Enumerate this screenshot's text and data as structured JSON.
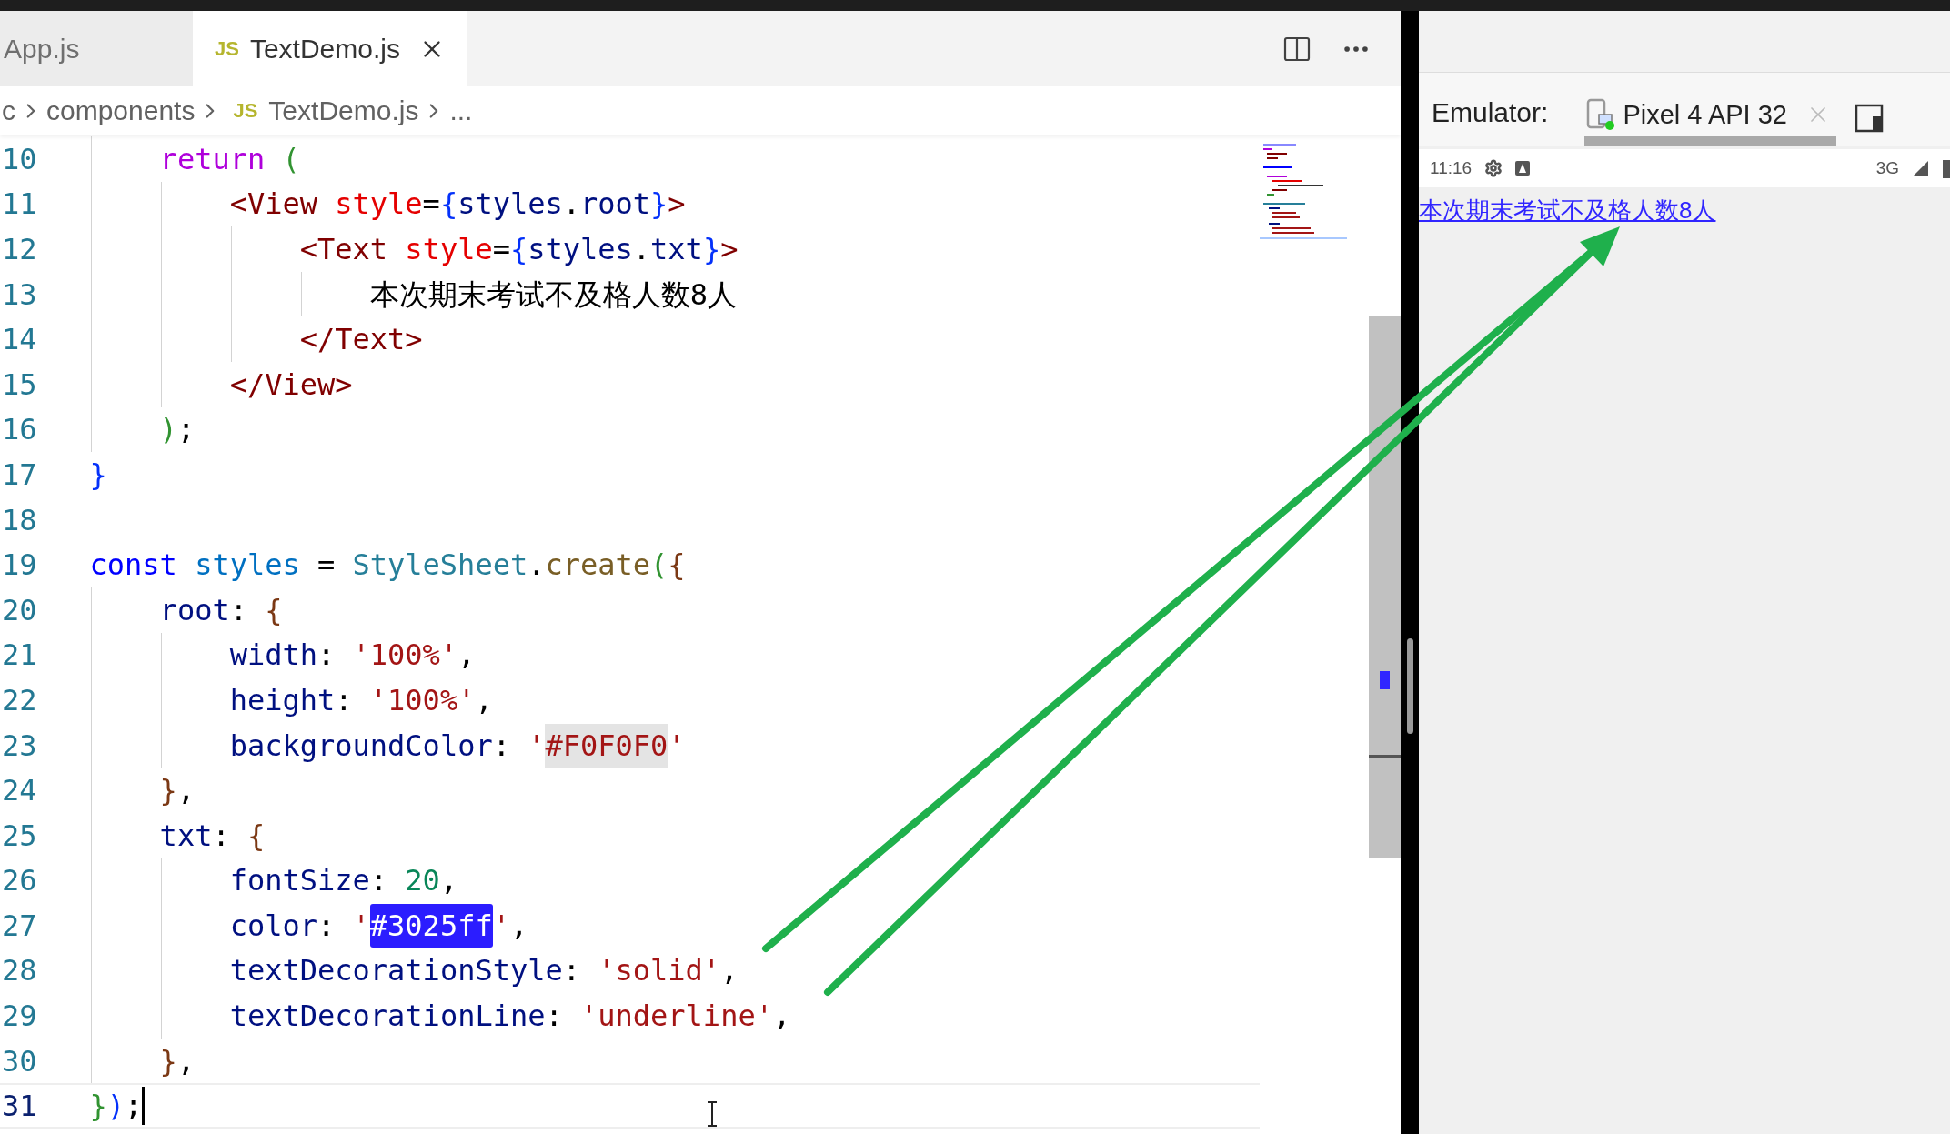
{
  "editor": {
    "tabs": [
      {
        "label": "App.js",
        "selected": false
      },
      {
        "label": "TextDemo.js",
        "badge": "JS",
        "selected": true
      }
    ],
    "breadcrumb": [
      {
        "text": "c"
      },
      {
        "text": "components"
      },
      {
        "text": "TextDemo.js",
        "badge": "JS"
      },
      {
        "text": "..."
      }
    ],
    "lines": [
      {
        "number": "10",
        "current": false,
        "tokens": [
          {
            "kind": "control",
            "text": "    return"
          },
          {
            "kind": "bracket2",
            "text": " ("
          }
        ]
      },
      {
        "number": "11",
        "current": false,
        "tokens": [
          {
            "kind": "tag",
            "text": "        <View"
          },
          {
            "kind": "attr",
            "text": " style"
          },
          {
            "kind": "plain",
            "text": "="
          },
          {
            "kind": "bracket1",
            "text": "{"
          },
          {
            "kind": "var",
            "text": "styles"
          },
          {
            "kind": "plain",
            "text": "."
          },
          {
            "kind": "var",
            "text": "root"
          },
          {
            "kind": "bracket1",
            "text": "}"
          },
          {
            "kind": "tag",
            "text": ">"
          }
        ]
      },
      {
        "number": "12",
        "current": false,
        "tokens": [
          {
            "kind": "tag",
            "text": "            <Text"
          },
          {
            "kind": "attr",
            "text": " style"
          },
          {
            "kind": "plain",
            "text": "="
          },
          {
            "kind": "bracket1",
            "text": "{"
          },
          {
            "kind": "var",
            "text": "styles"
          },
          {
            "kind": "plain",
            "text": "."
          },
          {
            "kind": "var",
            "text": "txt"
          },
          {
            "kind": "bracket1",
            "text": "}"
          },
          {
            "kind": "tag",
            "text": ">"
          }
        ]
      },
      {
        "number": "13",
        "current": false,
        "tokens": [
          {
            "kind": "plain",
            "text": "                本次期末考试不及格人数8人"
          }
        ]
      },
      {
        "number": "14",
        "current": false,
        "tokens": [
          {
            "kind": "tag",
            "text": "            </Text>"
          }
        ]
      },
      {
        "number": "15",
        "current": false,
        "tokens": [
          {
            "kind": "tag",
            "text": "        </View>"
          }
        ]
      },
      {
        "number": "16",
        "current": false,
        "tokens": [
          {
            "kind": "bracket2",
            "text": "    )"
          },
          {
            "kind": "plain",
            "text": ";"
          }
        ]
      },
      {
        "number": "17",
        "current": false,
        "tokens": [
          {
            "kind": "bracket1",
            "text": "}"
          }
        ]
      },
      {
        "number": "18",
        "current": false
      },
      {
        "number": "19",
        "current": false,
        "tokens": [
          {
            "kind": "keyword",
            "text": "const"
          },
          {
            "kind": "const",
            "text": " styles"
          },
          {
            "kind": "plain",
            "text": " = "
          },
          {
            "kind": "type",
            "text": "StyleSheet"
          },
          {
            "kind": "plain",
            "text": "."
          },
          {
            "kind": "func",
            "text": "create"
          },
          {
            "kind": "bracket2",
            "text": "("
          },
          {
            "kind": "bracket3",
            "text": "{"
          }
        ]
      },
      {
        "number": "20",
        "current": false,
        "tokens": [
          {
            "kind": "var",
            "text": "    root"
          },
          {
            "kind": "plain",
            "text": ": "
          },
          {
            "kind": "bracket3",
            "text": "{"
          }
        ]
      },
      {
        "number": "21",
        "current": false,
        "tokens": [
          {
            "kind": "var",
            "text": "        width"
          },
          {
            "kind": "plain",
            "text": ": "
          },
          {
            "kind": "string",
            "text": "'100%'"
          },
          {
            "kind": "plain",
            "text": ","
          }
        ]
      },
      {
        "number": "22",
        "current": false,
        "tokens": [
          {
            "kind": "var",
            "text": "        height"
          },
          {
            "kind": "plain",
            "text": ": "
          },
          {
            "kind": "string",
            "text": "'100%'"
          },
          {
            "kind": "plain",
            "text": ","
          }
        ]
      },
      {
        "number": "23",
        "current": false,
        "tokens": [
          {
            "kind": "var",
            "text": "        backgroundColor"
          },
          {
            "kind": "plain",
            "text": ": "
          },
          {
            "kind": "string",
            "text": "'"
          },
          {
            "kind": "match",
            "text": "#F0F0F0"
          },
          {
            "kind": "string",
            "text": "'"
          }
        ]
      },
      {
        "number": "24",
        "current": false,
        "tokens": [
          {
            "kind": "bracket3",
            "text": "    }"
          },
          {
            "kind": "plain",
            "text": ","
          }
        ]
      },
      {
        "number": "25",
        "current": false,
        "tokens": [
          {
            "kind": "var",
            "text": "    txt"
          },
          {
            "kind": "plain",
            "text": ": "
          },
          {
            "kind": "bracket3",
            "text": "{"
          }
        ]
      },
      {
        "number": "26",
        "current": false,
        "tokens": [
          {
            "kind": "var",
            "text": "        fontSize"
          },
          {
            "kind": "plain",
            "text": ": "
          },
          {
            "kind": "number",
            "text": "20"
          },
          {
            "kind": "plain",
            "text": ","
          }
        ]
      },
      {
        "number": "27",
        "current": false,
        "tokens": [
          {
            "kind": "var",
            "text": "        color"
          },
          {
            "kind": "plain",
            "text": ": "
          },
          {
            "kind": "string",
            "text": "'"
          },
          {
            "kind": "selection",
            "text": "#3025ff"
          },
          {
            "kind": "string",
            "text": "'"
          },
          {
            "kind": "plain",
            "text": ","
          }
        ]
      },
      {
        "number": "28",
        "current": false,
        "tokens": [
          {
            "kind": "var",
            "text": "        textDecorationStyle"
          },
          {
            "kind": "plain",
            "text": ": "
          },
          {
            "kind": "string",
            "text": "'solid'"
          },
          {
            "kind": "plain",
            "text": ","
          }
        ]
      },
      {
        "number": "29",
        "current": false,
        "tokens": [
          {
            "kind": "var",
            "text": "        textDecorationLine"
          },
          {
            "kind": "plain",
            "text": ": "
          },
          {
            "kind": "string",
            "text": "'underline'"
          },
          {
            "kind": "plain",
            "text": ","
          }
        ]
      },
      {
        "number": "30",
        "current": false,
        "tokens": [
          {
            "kind": "bracket3",
            "text": "    }"
          },
          {
            "kind": "plain",
            "text": ","
          }
        ]
      },
      {
        "number": "31",
        "current": true,
        "tokens": [
          {
            "kind": "bracket2",
            "text": "}"
          },
          {
            "kind": "bracket1",
            "text": ")"
          },
          {
            "kind": "plain",
            "text": ";"
          }
        ]
      }
    ]
  },
  "emulator": {
    "label": "Emulator:",
    "device": "Pixel 4 API 32",
    "status_bar": {
      "time": "11:16",
      "network": "3G"
    },
    "app_text": "本次期末考试不及格人数8人"
  }
}
